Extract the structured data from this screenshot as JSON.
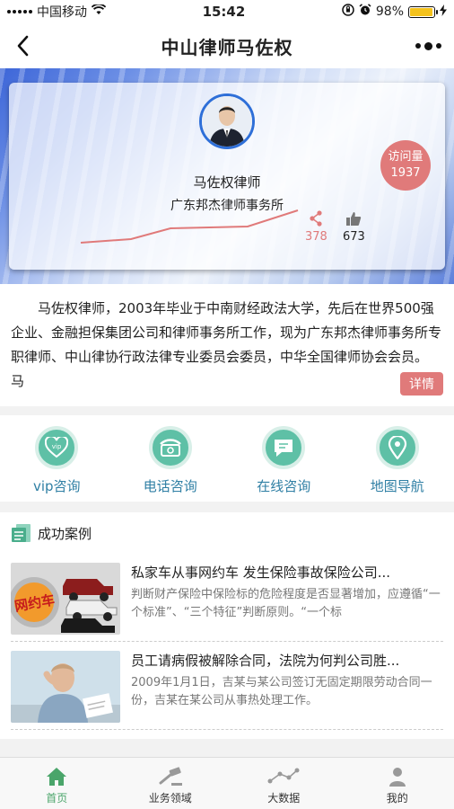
{
  "status_bar": {
    "carrier": "中国移动",
    "time": "15:42",
    "battery": "98%",
    "battery_level": 0.98
  },
  "nav": {
    "title": "中山律师马佐权"
  },
  "profile": {
    "name": "马佐权律师",
    "firm": "广东邦杰律师事务所",
    "visit_label": "访问量",
    "visit_count": "1937",
    "shares": "378",
    "likes": "673"
  },
  "intro": {
    "text": "马佐权律师，2003年毕业于中南财经政法大学，先后在世界500强企业、金融担保集团公司和律师事务所工作，现为广东邦杰律师事务所专职律师、中山律协行政法律专业委员会委员，中华全国律师协会会员。 马",
    "detail_button": "详情"
  },
  "services": [
    {
      "label": "vip咨询",
      "icon": "vip-icon"
    },
    {
      "label": "电话咨询",
      "icon": "phone-icon"
    },
    {
      "label": "在线咨询",
      "icon": "chat-icon"
    },
    {
      "label": "地图导航",
      "icon": "map-pin-icon"
    }
  ],
  "cases": {
    "heading": "成功案例",
    "items": [
      {
        "title": "私家车从事网约车 发生保险事故保险公司...",
        "desc": "判断财产保险中保险标的危险程度是否显著增加，应遵循“一个标准”、“三个特征”判断原则。“一个标",
        "thumb_text": "网约车"
      },
      {
        "title": "员工请病假被解除合同，法院为何判公司胜...",
        "desc": "2009年1月1日，吉某与某公司签订无固定期限劳动合同一份，吉某在某公司从事热处理工作。"
      }
    ]
  },
  "tabbar": [
    {
      "label": "首页",
      "icon": "home-icon",
      "active": true
    },
    {
      "label": "业务领域",
      "icon": "gavel-icon"
    },
    {
      "label": "大数据",
      "icon": "graph-icon"
    },
    {
      "label": "我的",
      "icon": "user-icon"
    }
  ],
  "colors": {
    "accent": "#e07a7a",
    "service": "#5ec0a6",
    "tab_active": "#4aa56a"
  }
}
